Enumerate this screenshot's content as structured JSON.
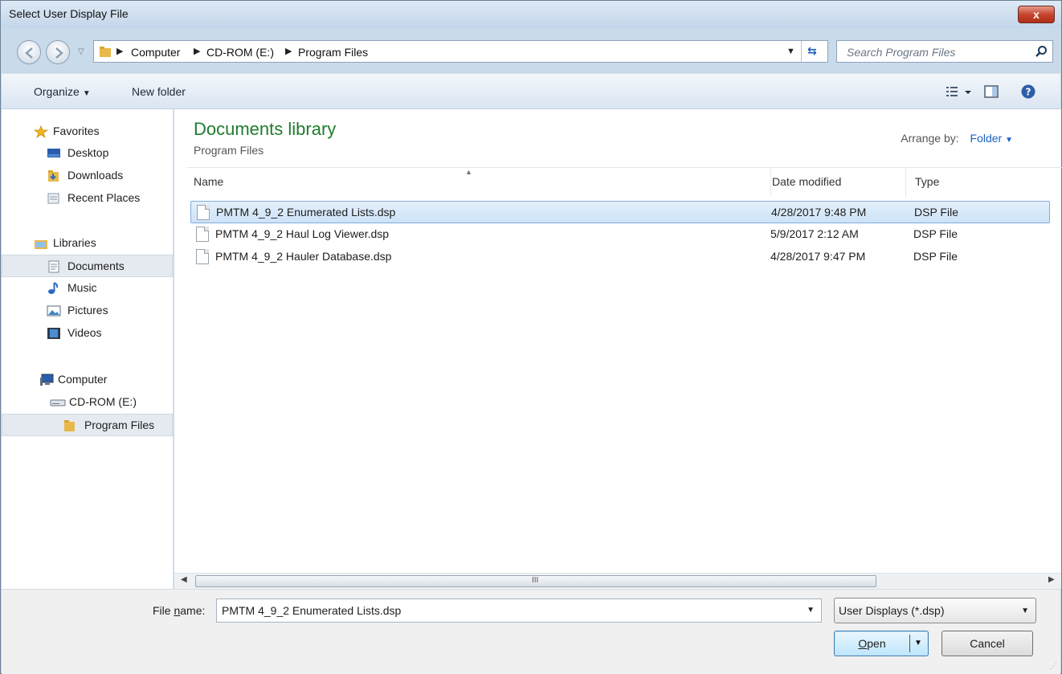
{
  "window": {
    "title": "Select User Display File",
    "close_label": "x"
  },
  "address": {
    "crumbs": [
      "Computer",
      "CD-ROM (E:)",
      "Program Files"
    ],
    "search_placeholder": "Search Program Files"
  },
  "toolbar": {
    "organize_label": "Organize",
    "new_folder_label": "New folder"
  },
  "nav": {
    "favorites": "Favorites",
    "desktop": "Desktop",
    "downloads": "Downloads",
    "recent": "Recent Places",
    "libraries": "Libraries",
    "documents": "Documents",
    "music": "Music",
    "pictures": "Pictures",
    "videos": "Videos",
    "computer": "Computer",
    "cdrom": "CD-ROM (E:)",
    "program_files": "Program Files"
  },
  "content": {
    "library_title": "Documents library",
    "library_subtitle": "Program Files",
    "arrange_label": "Arrange by:",
    "arrange_value": "Folder",
    "columns": {
      "name": "Name",
      "date": "Date modified",
      "type": "Type"
    },
    "files": [
      {
        "name": "PMTM 4_9_2 Enumerated Lists.dsp",
        "date": "4/28/2017 9:48 PM",
        "type": "DSP File"
      },
      {
        "name": "PMTM 4_9_2 Haul Log Viewer.dsp",
        "date": "5/9/2017 2:12 AM",
        "type": "DSP File"
      },
      {
        "name": "PMTM 4_9_2 Hauler Database.dsp",
        "date": "4/28/2017 9:47 PM",
        "type": "DSP File"
      }
    ]
  },
  "bottom": {
    "file_name_label_pre": "File ",
    "file_name_label_u": "n",
    "file_name_label_post": "ame:",
    "file_name_value": "PMTM 4_9_2 Enumerated Lists.dsp",
    "file_type_value": "User Displays (*.dsp)",
    "open_label_u": "O",
    "open_label_rest": "pen",
    "cancel_label": "Cancel"
  },
  "colors": {
    "accent": "#1a64c2",
    "library_title": "#1e7d2e",
    "selection": "#cde3f8"
  }
}
